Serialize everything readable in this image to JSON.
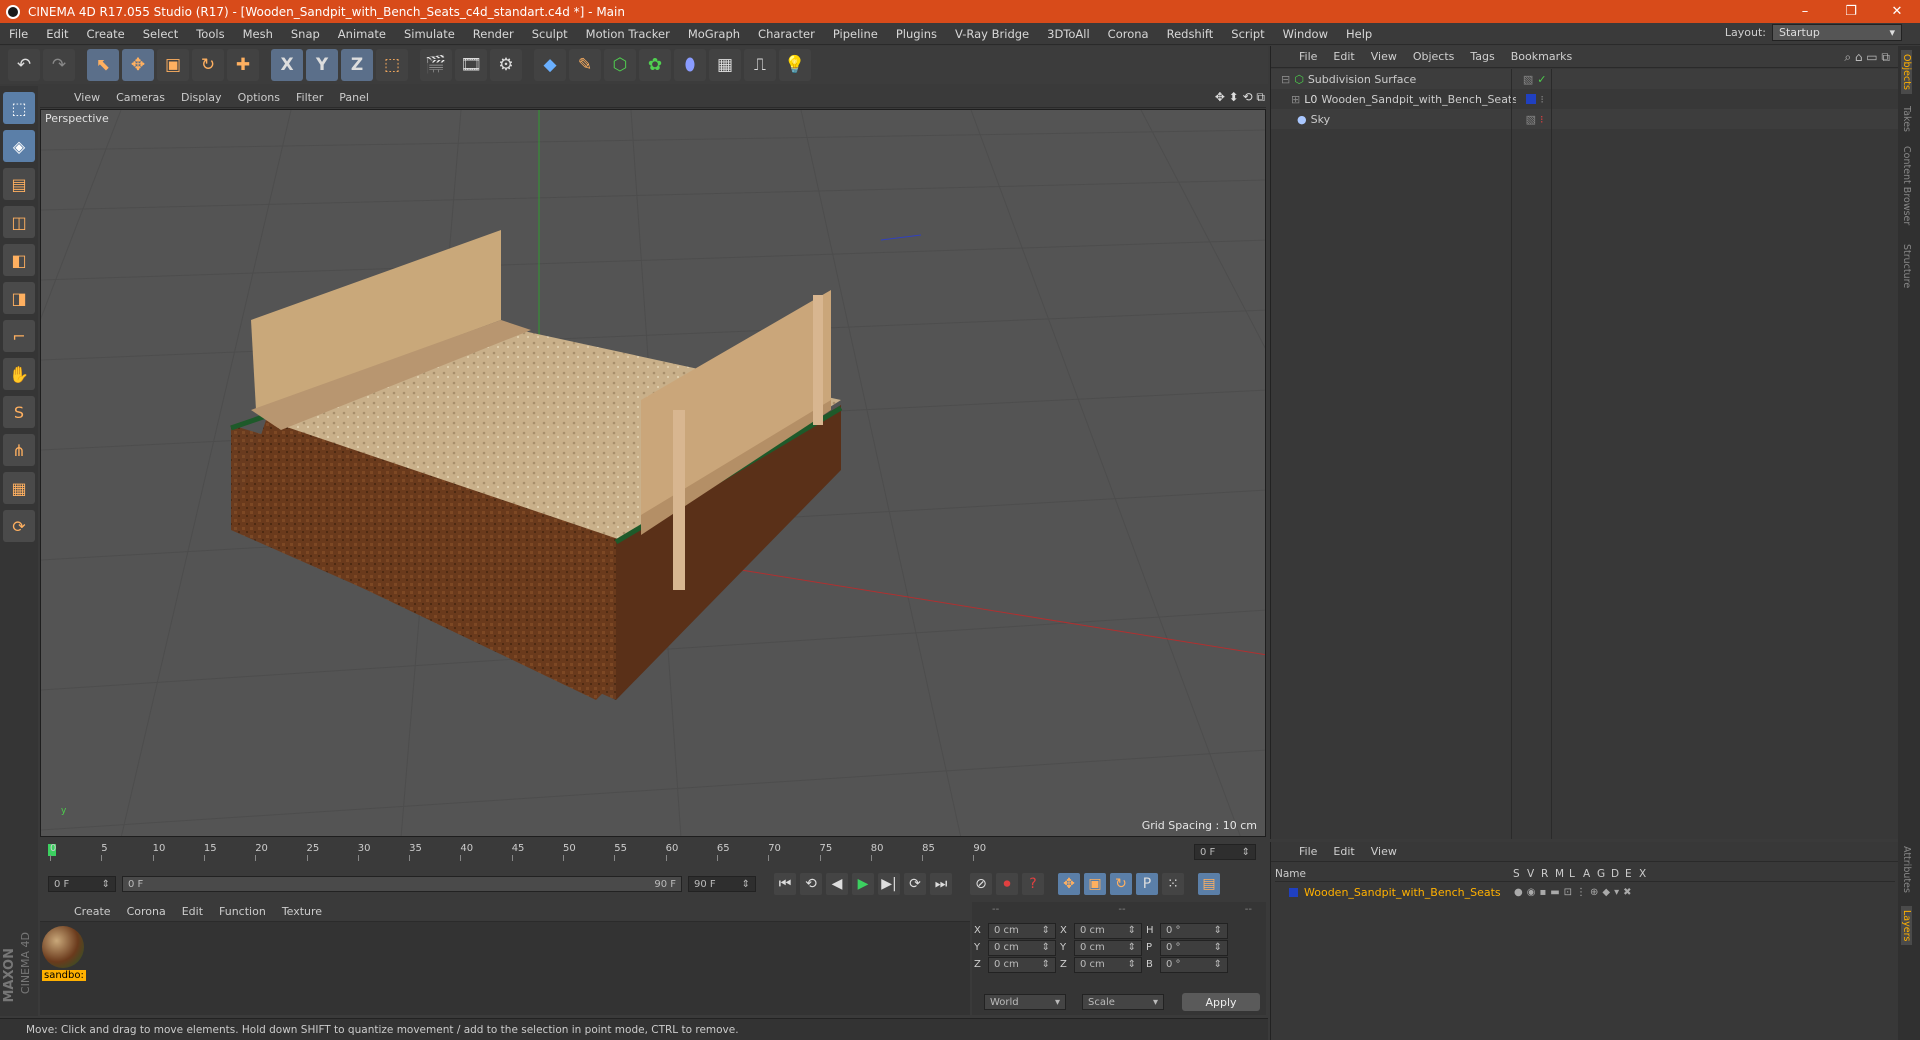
{
  "window": {
    "title": "CINEMA 4D R17.055 Studio (R17) - [Wooden_Sandpit_with_Bench_Seats_c4d_standart.c4d *] - Main",
    "minimize": "–",
    "restore": "❐",
    "close": "✕"
  },
  "menu": [
    "File",
    "Edit",
    "Create",
    "Select",
    "Tools",
    "Mesh",
    "Snap",
    "Animate",
    "Simulate",
    "Render",
    "Sculpt",
    "Motion Tracker",
    "MoGraph",
    "Character",
    "Pipeline",
    "Plugins",
    "V-Ray Bridge",
    "3DToAll",
    "Corona",
    "Redshift",
    "Script",
    "Window",
    "Help"
  ],
  "layout": {
    "label": "Layout:",
    "value": "Startup"
  },
  "toolbar": {
    "undo": "↶",
    "redo": "↷",
    "tools": [
      "⬉",
      "✥",
      "▣",
      "↻",
      "✚"
    ],
    "axes": [
      "X",
      "Y",
      "Z"
    ],
    "coord": "⬚",
    "render": [
      "🎬",
      "🎞",
      "⚙"
    ],
    "objects": [
      "◆",
      "✎",
      "⬡",
      "✿",
      "⬮",
      "▦",
      "⎍",
      "💡"
    ]
  },
  "lefttools": [
    "⬚",
    "◈",
    "▤",
    "◫",
    "◧",
    "◨",
    "⌐",
    "✋",
    "S",
    "⋔",
    "▦",
    "⟳"
  ],
  "viewport": {
    "menu": [
      "View",
      "Cameras",
      "Display",
      "Options",
      "Filter",
      "Panel"
    ],
    "label": "Perspective",
    "grid_spacing": "Grid Spacing : 10 cm",
    "nav_icons": "✥ ⬍ ⟲ ⧉"
  },
  "timeline": {
    "ticks": [
      "0",
      "5",
      "10",
      "15",
      "20",
      "25",
      "30",
      "35",
      "40",
      "45",
      "50",
      "55",
      "60",
      "65",
      "70",
      "75",
      "80",
      "85",
      "90"
    ],
    "frame_field": "0 F"
  },
  "transport": {
    "start": "0 F",
    "range_start": "0 F",
    "range_end": "90 F",
    "end": "90 F",
    "buttons": [
      "⏮",
      "⟲",
      "◀",
      "▶",
      "▶|",
      "⟳",
      "⏭"
    ],
    "record": [
      "⊘",
      "⏺",
      "?"
    ],
    "keys": [
      "✥",
      "▣",
      "↻",
      "P",
      "⁙",
      "▤"
    ]
  },
  "material_manager": {
    "menu": [
      "Create",
      "Corona",
      "Edit",
      "Function",
      "Texture"
    ],
    "material_name": "sandbo:"
  },
  "coordinates": {
    "header": [
      "--",
      "--",
      "--"
    ],
    "rows": [
      {
        "a": "X",
        "av": "0 cm",
        "b": "X",
        "bv": "0 cm",
        "c": "H",
        "cv": "0 °"
      },
      {
        "a": "Y",
        "av": "0 cm",
        "b": "Y",
        "bv": "0 cm",
        "c": "P",
        "cv": "0 °"
      },
      {
        "a": "Z",
        "av": "0 cm",
        "b": "Z",
        "bv": "0 cm",
        "c": "B",
        "cv": "0 °"
      }
    ],
    "mode1": "World",
    "mode2": "Scale",
    "apply": "Apply"
  },
  "maxon": {
    "line1": "MAXON",
    "line2": "CINEMA 4D"
  },
  "status": "Move: Click and drag to move elements. Hold down SHIFT to quantize movement / add to the selection in point mode, CTRL to remove.",
  "objects_panel": {
    "menu": [
      "File",
      "Edit",
      "View",
      "Objects",
      "Tags",
      "Bookmarks"
    ],
    "items": [
      {
        "name": "Subdivision Surface",
        "indent": 0
      },
      {
        "name": "Wooden_Sandpit_with_Bench_Seats",
        "indent": 1
      },
      {
        "name": "Sky",
        "indent": 0
      }
    ]
  },
  "layers_panel": {
    "menu": [
      "File",
      "Edit",
      "View"
    ],
    "columns": {
      "name": "Name",
      "flags": [
        "S",
        "V",
        "R",
        "M",
        "L",
        "A",
        "G",
        "D",
        "E",
        "X"
      ]
    },
    "row": "Wooden_Sandpit_with_Bench_Seats"
  },
  "side_tabs": [
    "Objects",
    "Takes",
    "Content Browser",
    "Structure",
    "Attributes",
    "Layers"
  ],
  "colors": {
    "title_bar": "#d84b1a",
    "accent": "#5b7fa8",
    "layer_text": "#ffb000"
  }
}
